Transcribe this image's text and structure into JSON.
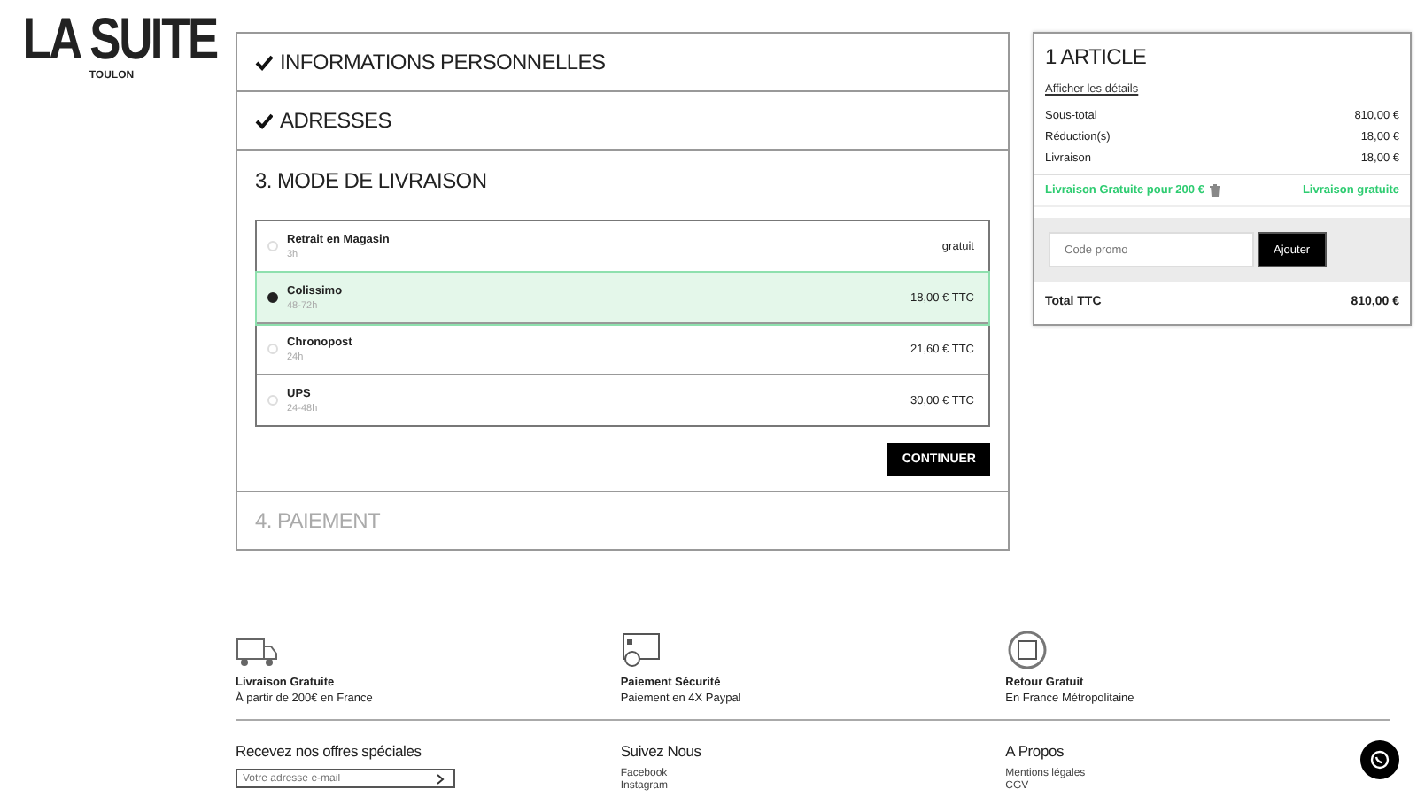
{
  "logo": {
    "name": "LA SUITE",
    "city": "TOULON"
  },
  "steps": [
    {
      "title": "INFORMATIONS PERSONNELLES",
      "completed": true,
      "expanded": false
    },
    {
      "title": "ADRESSES",
      "completed": true,
      "expanded": false
    },
    {
      "title": "3. MODE DE LIVRAISON",
      "completed": false,
      "expanded": true
    },
    {
      "title": "4. PAIEMENT",
      "completed": false,
      "expanded": false
    }
  ],
  "carriers": [
    {
      "name": "Retrait en Magasin",
      "delay": "3h",
      "price": "gratuit",
      "selected": false
    },
    {
      "name": "Colissimo",
      "delay": "48-72h",
      "price": "18,00 € TTC",
      "selected": true
    },
    {
      "name": "Chronopost",
      "delay": "24h",
      "price": "21,60 € TTC",
      "selected": false
    },
    {
      "name": "UPS",
      "delay": "24-48h",
      "price": "30,00 € TTC",
      "selected": false
    }
  ],
  "continue_button": "CONTINUER",
  "summary": {
    "title": "1 ARTICLE",
    "details_link": "Afficher les détails",
    "lines": [
      {
        "label": "Sous-total",
        "value": "810,00 €"
      },
      {
        "label": "Réduction(s)",
        "value": "18,00 €"
      },
      {
        "label": "Livraison",
        "value": "18,00 €"
      }
    ],
    "voucher": {
      "label": "Livraison Gratuite pour 200 €",
      "value": "Livraison gratuite"
    },
    "promo": {
      "placeholder": "Code promo",
      "button": "Ajouter"
    },
    "total": {
      "label": "Total TTC",
      "value": "810,00 €"
    }
  },
  "footer": {
    "features": [
      {
        "kind": "truck",
        "title": "Livraison Gratuite",
        "text": "À partir de 200€ en France"
      },
      {
        "kind": "card",
        "title": "Paiement Sécurité",
        "text": "Paiement en 4X Paypal"
      },
      {
        "kind": "return",
        "title": "Retour Gratuit",
        "text": "En France Métropolitaine"
      }
    ],
    "newsletter": {
      "title": "Recevez nos offres spéciales",
      "placeholder": "Votre adresse e-mail"
    },
    "columns": [
      {
        "title": "Suivez Nous",
        "links": [
          "Facebook",
          "Instagram"
        ]
      },
      {
        "title": "A Propos",
        "links": [
          "Mentions légales",
          "CGV"
        ]
      }
    ]
  }
}
